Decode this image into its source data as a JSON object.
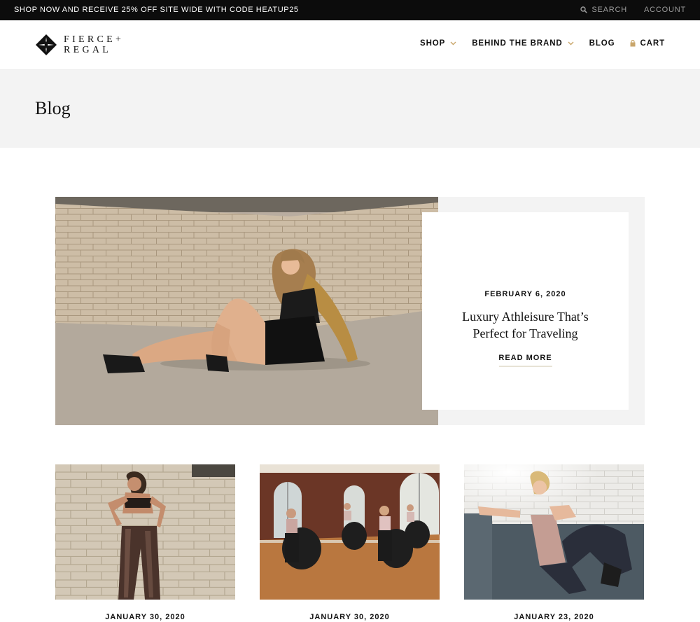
{
  "announcement": {
    "promo": "SHOP NOW AND RECEIVE 25% OFF SITE WIDE WITH CODE HEATUP25",
    "search_label": "SEARCH",
    "account_label": "ACCOUNT"
  },
  "brand": {
    "line1": "FIERCE+",
    "line2": "REGAL"
  },
  "nav": {
    "shop": "SHOP",
    "behind": "BEHIND THE BRAND",
    "blog": "BLOG",
    "cart": "CART"
  },
  "page": {
    "title": "Blog"
  },
  "featured": {
    "date": "FEBRUARY 6, 2020",
    "title_line1": "Luxury Athleisure That’s",
    "title_line2": "Perfect for Traveling",
    "read_more": "READ MORE"
  },
  "posts": [
    {
      "date": "JANUARY 30, 2020"
    },
    {
      "date": "JANUARY 30, 2020"
    },
    {
      "date": "JANUARY 23, 2020"
    }
  ],
  "colors": {
    "accent_gold": "#c9a66b",
    "announcement_bg": "#0c0c0c",
    "band_bg": "#f3f3f3"
  },
  "icons": [
    "search-icon",
    "chevron-down-icon",
    "cart-icon",
    "brand-logo-icon"
  ]
}
